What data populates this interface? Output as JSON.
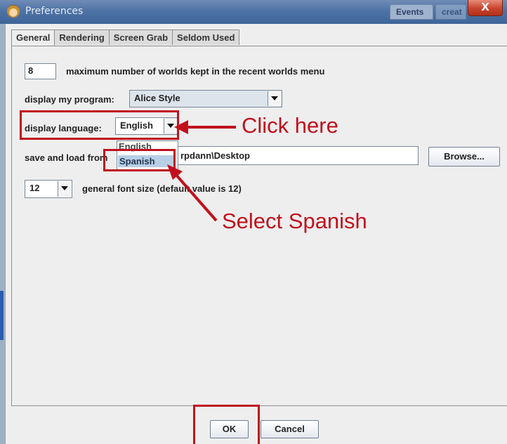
{
  "window": {
    "title": "Preferences",
    "background_tabs": [
      "Events",
      "creat"
    ],
    "close_label": "X"
  },
  "tabs": [
    {
      "label": "General",
      "active": true
    },
    {
      "label": "Rendering",
      "active": false
    },
    {
      "label": "Screen Grab",
      "active": false
    },
    {
      "label": "Seldom Used",
      "active": false
    }
  ],
  "general": {
    "recent_worlds": {
      "value": "8",
      "label": "maximum number of worlds kept in the recent worlds menu"
    },
    "display_program": {
      "label": "display my program:",
      "selected": "Alice Style"
    },
    "display_language": {
      "label": "display language:",
      "selected": "English",
      "options": [
        "English",
        "Spanish"
      ],
      "highlighted_option": "Spanish"
    },
    "save_load": {
      "label": "save and load from",
      "path_visible": "rpdann\\Desktop",
      "browse_label": "Browse..."
    },
    "font_size": {
      "value": "12",
      "label": "general font size (default value is 12)"
    }
  },
  "buttons": {
    "ok": "OK",
    "cancel": "Cancel"
  },
  "annotations": {
    "click_here": "Click here",
    "select_spanish": "Select Spanish",
    "color": "#c0111d"
  },
  "icons": [
    "alice-app-icon",
    "dropdown-arrow-icon",
    "close-icon"
  ]
}
